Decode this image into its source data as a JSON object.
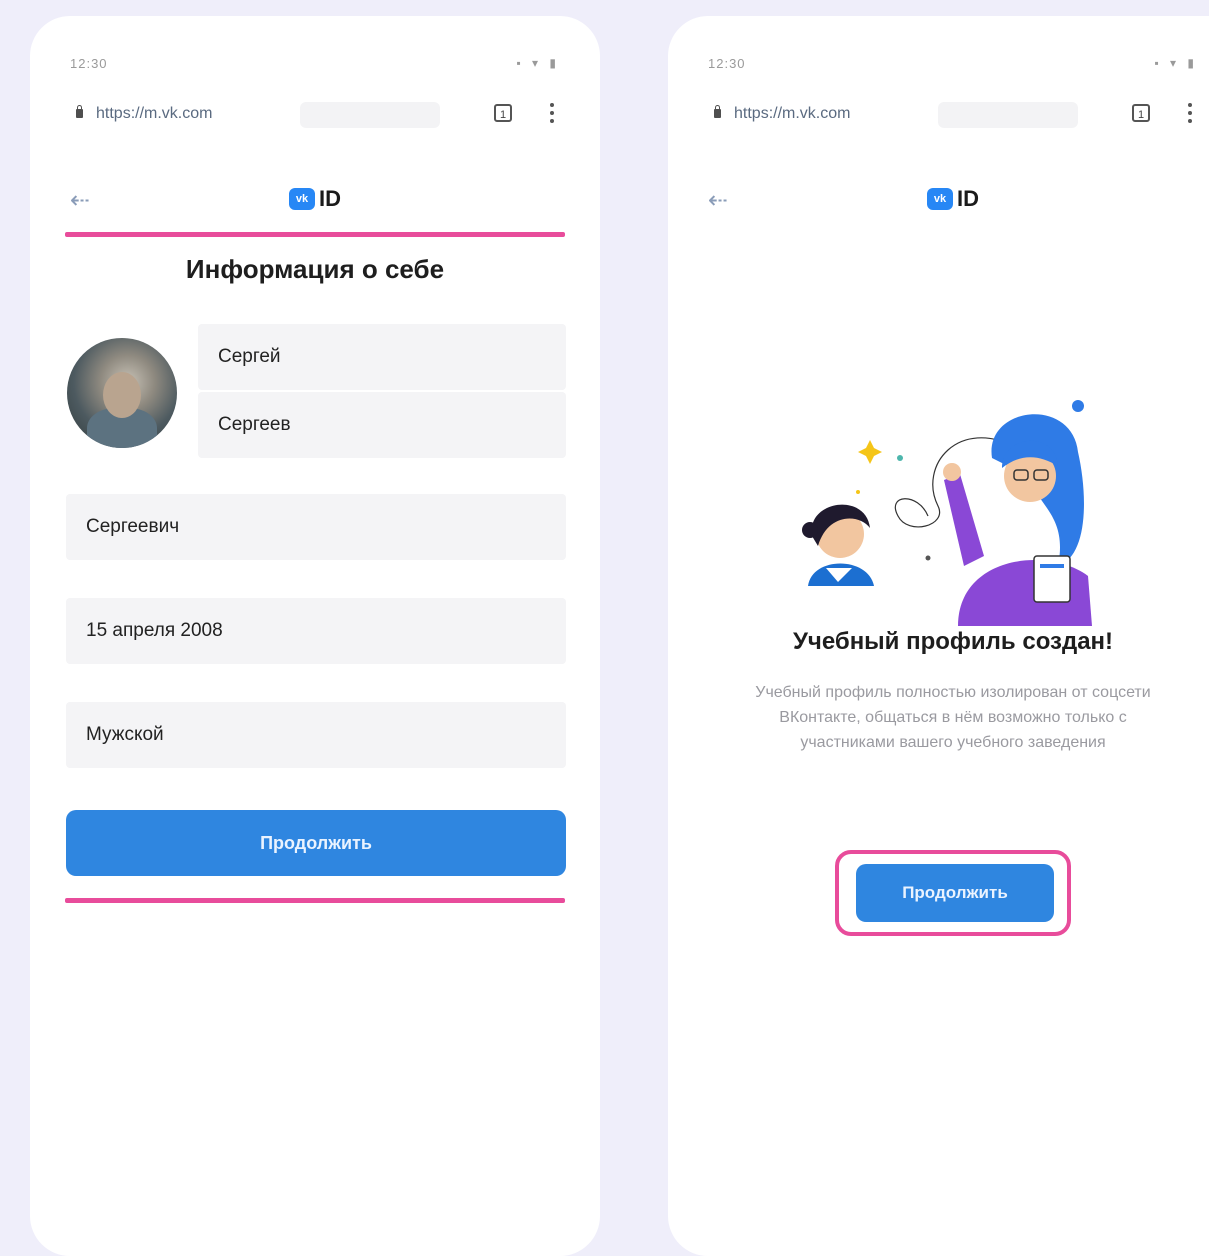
{
  "left_screen": {
    "status_time": "12:30",
    "url": "https://m.vk.com",
    "tab_count": "1",
    "logo_text": "ID",
    "logo_badge": "vk",
    "title": "Информация о себе",
    "first_name": "Сергей",
    "last_name": "Сергеев",
    "patronymic": "Сергеевич",
    "birth_date": "15 апреля 2008",
    "gender": "Мужской",
    "continue_label": "Продолжить"
  },
  "right_screen": {
    "status_time": "12:30",
    "url": "https://m.vk.com",
    "tab_count": "1",
    "logo_text": "ID",
    "logo_badge": "vk",
    "success_title": "Учебный профиль создан!",
    "success_description": "Учебный профиль полностью изолирован от соцсети ВКонтакте, общаться в нём возможно только с участниками вашего учебного заведения",
    "continue_label": "Продолжить"
  },
  "colors": {
    "accent_highlight": "#e84c9b",
    "primary_button": "#2f86e0",
    "vk_blue": "#2787f5",
    "background": "#efeefa"
  }
}
